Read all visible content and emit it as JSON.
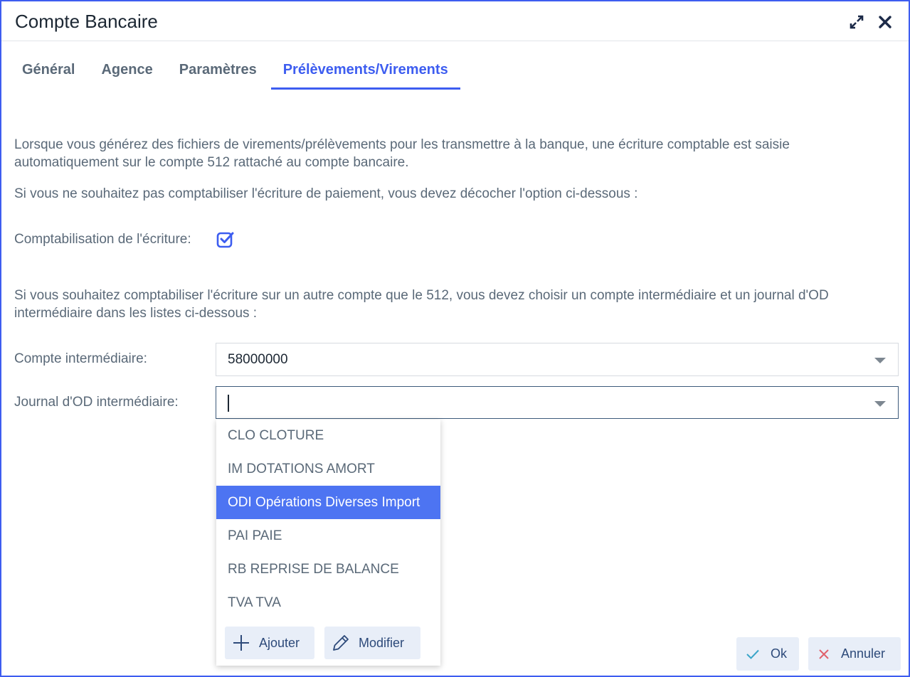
{
  "window": {
    "title": "Compte Bancaire",
    "expand_icon": "expand-icon",
    "close_icon": "close-icon"
  },
  "tabs": [
    {
      "label": "Général",
      "active": false
    },
    {
      "label": "Agence",
      "active": false
    },
    {
      "label": "Paramètres",
      "active": false
    },
    {
      "label": "Prélèvements/Virements",
      "active": true
    }
  ],
  "content": {
    "intro_line1": "Lorsque vous générez des fichiers de virements/prélèvements pour les transmettre à la banque, une écriture comptable est saisie",
    "intro_line2": "automatiquement sur le compte 512 rattaché au compte bancaire.",
    "uncheck_note": "Si vous ne souhaitez pas comptabiliser l'écriture de paiement, vous devez décocher l'option ci-dessous :",
    "comptabilisation_label": "Comptabilisation de l'écriture:",
    "comptabilisation_checked": true,
    "other_account_line1": "Si vous souhaitez comptabiliser l'écriture sur un autre compte que le 512, vous devez choisir un compte intermédiaire et un journal d'OD",
    "other_account_line2": "intermédiaire dans les listes ci-dessous :"
  },
  "form": {
    "compte_label": "Compte intermédiaire:",
    "compte_value": "58000000",
    "journal_label": "Journal d'OD intermédiaire:",
    "journal_value": ""
  },
  "dropdown": {
    "options": [
      {
        "label": "CLO CLOTURE",
        "selected": false
      },
      {
        "label": "IM DOTATIONS AMORT",
        "selected": false
      },
      {
        "label": "ODI Opérations Diverses Import",
        "selected": true
      },
      {
        "label": "PAI PAIE",
        "selected": false
      },
      {
        "label": "RB REPRISE DE BALANCE",
        "selected": false
      },
      {
        "label": "TVA TVA",
        "selected": false
      }
    ],
    "add_label": "Ajouter",
    "add_icon": "plus-icon",
    "edit_label": "Modifier",
    "edit_icon": "pencil-icon"
  },
  "footer": {
    "ok_label": "Ok",
    "ok_icon": "check-icon",
    "cancel_label": "Annuler",
    "cancel_icon": "x-icon"
  },
  "colors": {
    "accent": "#3d5df0",
    "selected_option": "#4d74f2",
    "button_bg": "#e8eef8",
    "text": "#5a6978",
    "title_text": "#1c2733"
  }
}
